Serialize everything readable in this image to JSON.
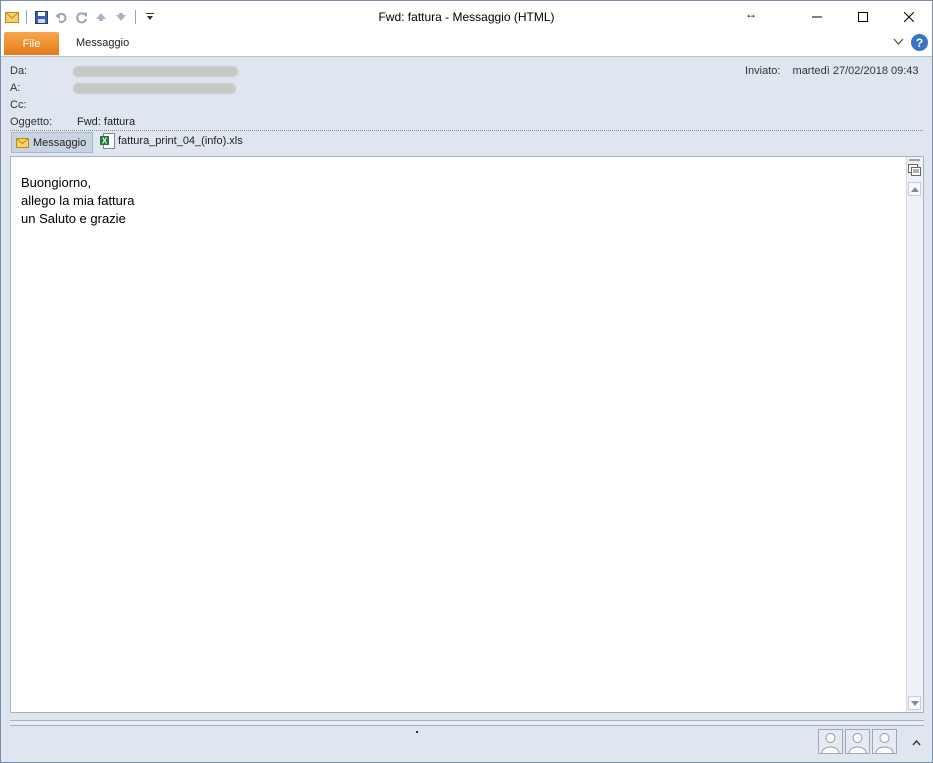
{
  "window": {
    "title": "Fwd: fattura  -  Messaggio (HTML)"
  },
  "ribbon": {
    "file_tab": "File",
    "message_tab": "Messaggio"
  },
  "header": {
    "from_label": "Da:",
    "to_label": "A:",
    "cc_label": "Cc:",
    "subject_label": "Oggetto:",
    "subject_value": "Fwd: fattura",
    "sent_label": "Inviato:",
    "sent_value": "martedì 27/02/2018 09:43"
  },
  "attachments": {
    "message_tab": "Messaggio",
    "file_name": "fattura_print_04_(info).xls"
  },
  "body": {
    "lines": [
      "Buongiorno,",
      "allego la mia fattura",
      "un Saluto e grazie"
    ]
  },
  "colors": {
    "file_tab": "#e67a19",
    "help": "#3a72c6",
    "excel_icon": "#1f7a3d"
  }
}
